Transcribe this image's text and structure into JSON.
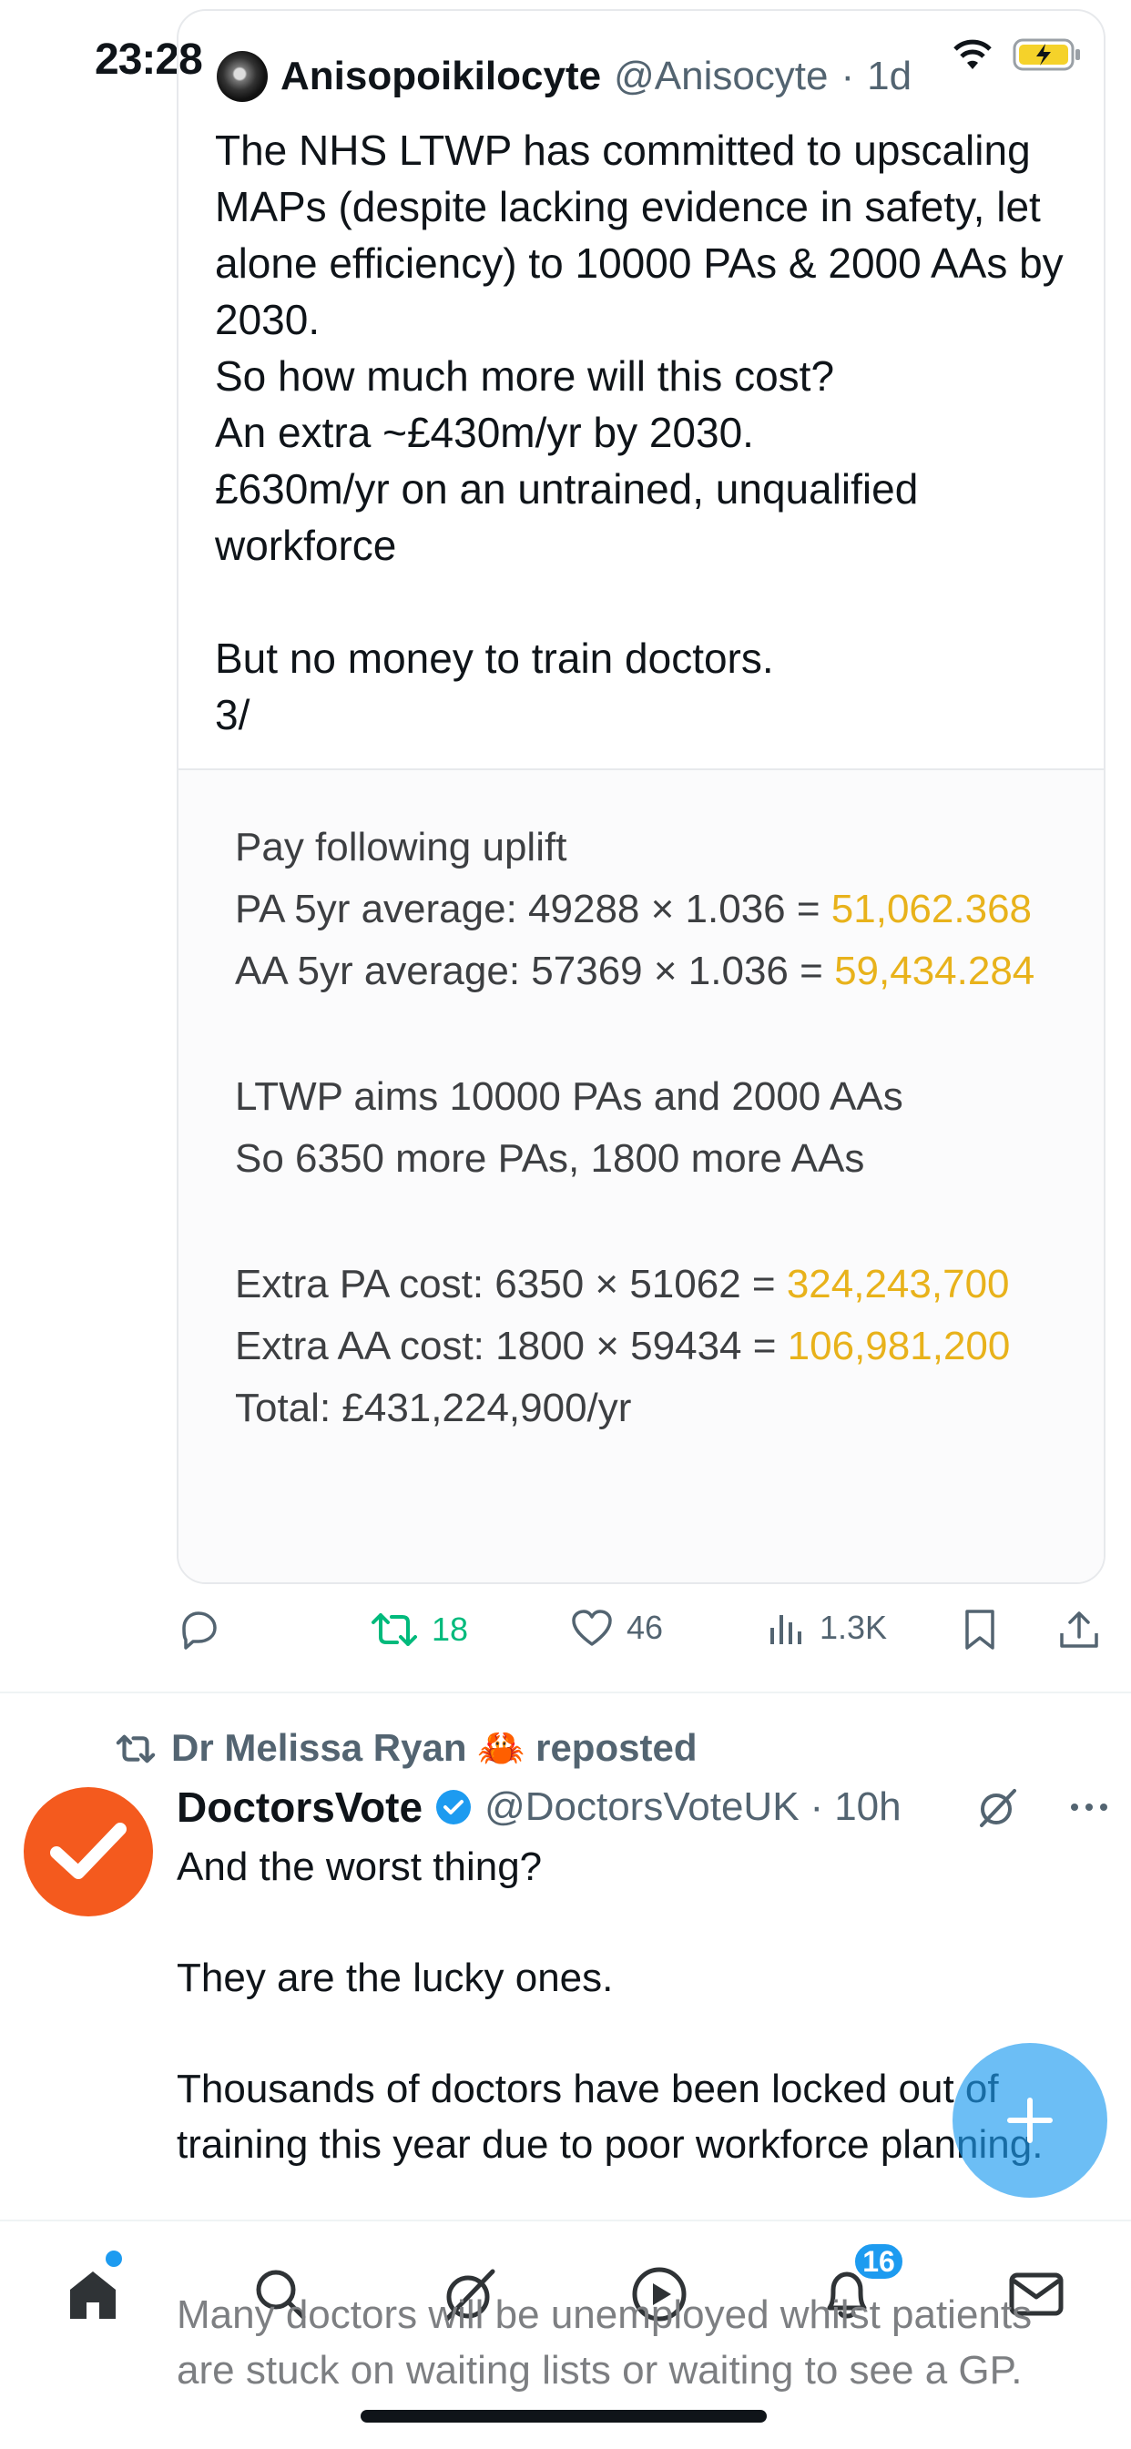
{
  "status_bar": {
    "time": "23:28"
  },
  "quote_tweet": {
    "author_name": "Anisopoikilocyte",
    "author_handle": "@Anisocyte",
    "time": "1d",
    "text": "The NHS LTWP has committed to upscaling MAPs (despite lacking evidence in safety, let alone efficiency) to 10000 PAs & 2000 AAs by 2030.\nSo how much more will this cost?\nAn extra ~£430m/yr by 2030.\n£630m/yr on an untrained, unqualified workforce\n\nBut no money to train doctors.\n3/",
    "image_lines": {
      "heading": "Pay following uplift",
      "pa_avg_label": "PA 5yr average: 49288 × 1.036 =",
      "pa_avg_value": "51,062.368",
      "aa_avg_label": "AA 5yr average: 57369 × 1.036 =",
      "aa_avg_value": "59,434.284",
      "aims": "LTWP aims 10000 PAs and 2000 AAs",
      "more": "So 6350 more PAs, 1800 more AAs",
      "pa_cost_label": "Extra PA cost: 6350 × 51062 =",
      "pa_cost_value": "324,243,700",
      "aa_cost_label": "Extra AA cost: 1800 × 59434 =",
      "aa_cost_value": "106,981,200",
      "total": "Total: £431,224,900/yr"
    }
  },
  "actions": {
    "replies": "",
    "reposts": "18",
    "likes": "46",
    "views": "1.3K"
  },
  "second_tweet": {
    "repost_by": "Dr Melissa Ryan 🦀 reposted",
    "author_name": "DoctorsVote",
    "author_handle": "@DoctorsVoteUK",
    "time": "10h",
    "text": "And the worst thing?\n\nThey are the lucky ones.\n\nThousands of doctors have been locked out of training this year due to poor workforce planning.",
    "text_continued": "Many doctors will be unemployed whilst patients are stuck on waiting lists or waiting to see a GP."
  },
  "bottom_nav": {
    "notifications_badge": "16"
  },
  "colors": {
    "accent": "#1d9bf0",
    "repost_green": "#00ba7c",
    "highlight": "#e8b21b",
    "avatar_orange": "#f45a1e"
  }
}
